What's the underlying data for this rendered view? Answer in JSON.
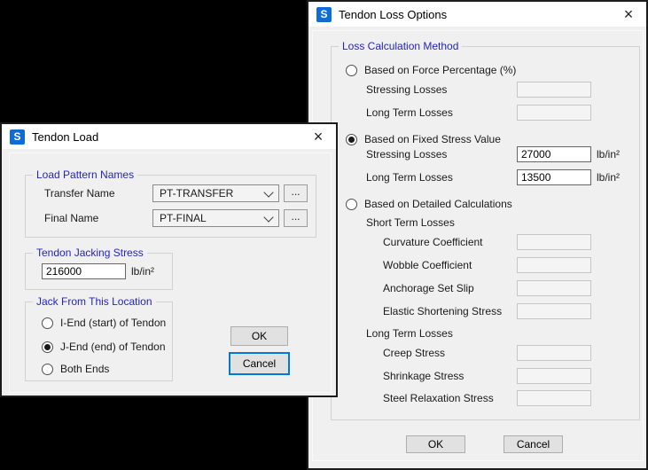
{
  "icons": {
    "app_letter": "S",
    "close_glyph": "×",
    "browse_dots": "..."
  },
  "colors": {
    "accent_blue": "#0e6cd6",
    "group_label_blue": "#2424c0",
    "focus_blue": "#0078d7",
    "titlebar_bg": "#ffffff",
    "dialog_bg": "#f0f0f0"
  },
  "tendon_load": {
    "title": "Tendon Load",
    "load_pattern": {
      "legend": "Load Pattern Names",
      "transfer_label": "Transfer Name",
      "transfer_value": "PT-TRANSFER",
      "final_label": "Final Name",
      "final_value": "PT-FINAL"
    },
    "jacking_stress": {
      "legend": "Tendon Jacking Stress",
      "value": "216000",
      "unit": "lb/in²"
    },
    "jack_location": {
      "legend": "Jack From This Location",
      "options": [
        {
          "label": "I-End (start) of Tendon",
          "selected": false
        },
        {
          "label": "J-End (end) of Tendon",
          "selected": true
        },
        {
          "label": "Both Ends",
          "selected": false
        }
      ]
    },
    "buttons": {
      "ok": "OK",
      "cancel": "Cancel"
    }
  },
  "tendon_loss": {
    "title": "Tendon Loss Options",
    "group_legend": "Loss Calculation Method",
    "methods": {
      "force_percentage": {
        "label": "Based on Force Percentage (%)",
        "selected": false,
        "rows": [
          {
            "label": "Stressing Losses",
            "value": ""
          },
          {
            "label": "Long Term Losses",
            "value": ""
          }
        ]
      },
      "fixed_stress": {
        "label": "Based on Fixed Stress Value",
        "selected": true,
        "rows": [
          {
            "label": "Stressing Losses",
            "value": "27000",
            "unit": "lb/in²"
          },
          {
            "label": "Long Term Losses",
            "value": "13500",
            "unit": "lb/in²"
          }
        ]
      },
      "detailed": {
        "label": "Based on Detailed Calculations",
        "selected": false,
        "short_term": {
          "header": "Short Term Losses",
          "rows": [
            "Curvature Coefficient",
            "Wobble Coefficient",
            "Anchorage Set Slip",
            "Elastic Shortening Stress"
          ]
        },
        "long_term": {
          "header": "Long Term Losses",
          "rows": [
            "Creep Stress",
            "Shrinkage Stress",
            "Steel Relaxation Stress"
          ]
        }
      }
    },
    "buttons": {
      "ok": "OK",
      "cancel": "Cancel"
    }
  }
}
